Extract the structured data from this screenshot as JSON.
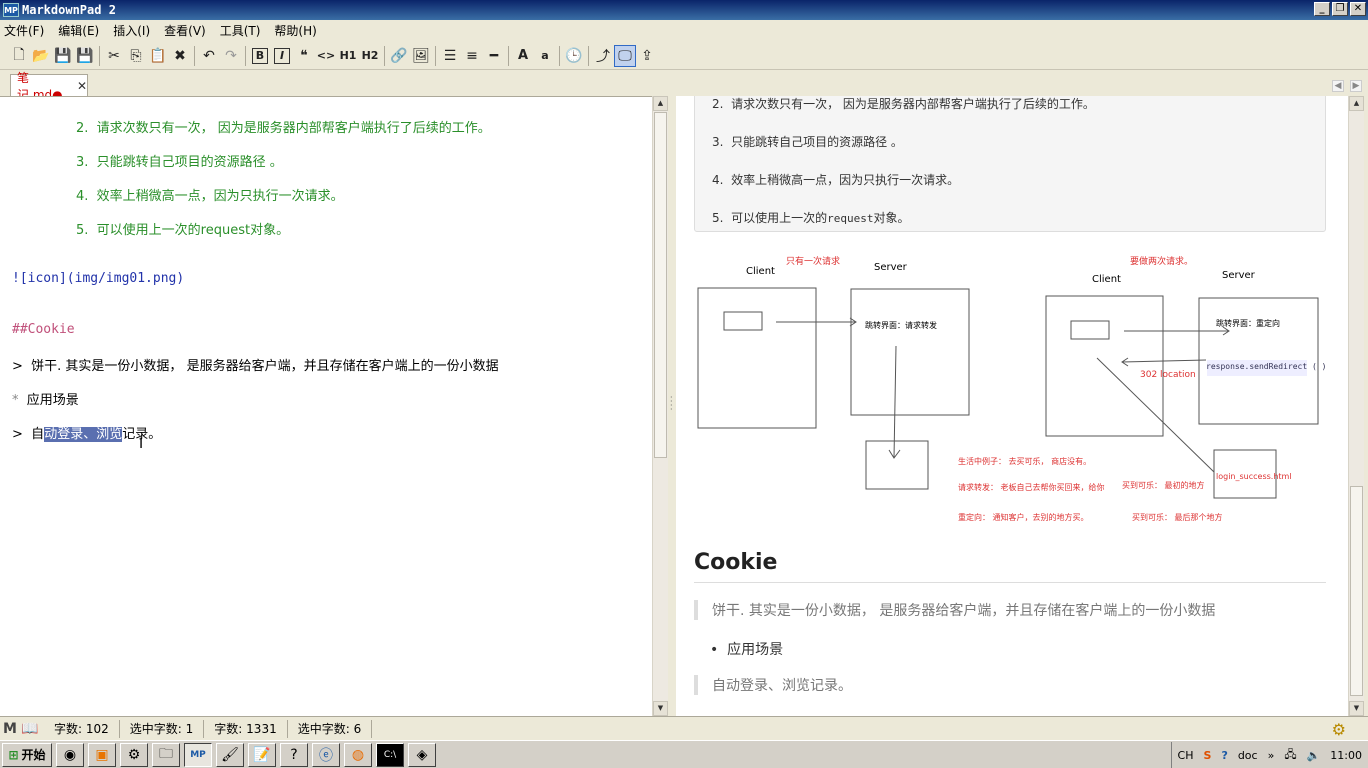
{
  "window": {
    "title": "MarkdownPad 2",
    "app_icon": "MP",
    "btn_minimize": "_",
    "btn_restore": "❐",
    "btn_close": "✕"
  },
  "menu": [
    "文件(F)",
    "编辑(E)",
    "插入(I)",
    "查看(V)",
    "工具(T)",
    "帮助(H)"
  ],
  "toolbar": {
    "h1": "H1",
    "h2": "H2",
    "bold": "B",
    "italic": "I",
    "font_big": "A",
    "font_small": "a",
    "quote": "❝",
    "code": "<>"
  },
  "tab": {
    "label": "笔记.md●",
    "close": "✕"
  },
  "editor": {
    "lines": [
      {
        "num": "2.",
        "text": "请求次数只有一次， 因为是服务器内部帮客户端执行了后续的工作。"
      },
      {
        "num": "3.",
        "text": "只能跳转自己项目的资源路径 。"
      },
      {
        "num": "4.",
        "text": "效率上稍微高一点，因为只执行一次请求。"
      },
      {
        "num": "5.",
        "text": "可以使用上一次的request对象。"
      }
    ],
    "image_md": "![icon](img/img01.png)",
    "heading_md": "##Cookie",
    "quote1_mark": ">",
    "quote1_text": "饼干. 其实是一份小数据， 是服务器给客户端，并且存储在客户端上的一份小数据",
    "list_mark": "*",
    "list_text": "应用场景",
    "quote2_mark": ">",
    "quote2_pre": "自",
    "quote2_sel": "动登录、浏览",
    "quote2_post": "记录。"
  },
  "preview": {
    "items": [
      {
        "num": "2.",
        "pre": "请求次数只有一次， 因为是服务器内部帮客户端执行了后续的工作。",
        "mono": "",
        "post": ""
      },
      {
        "num": "3.",
        "pre": "只能跳转自己项目的资源路径 。",
        "mono": "",
        "post": ""
      },
      {
        "num": "4.",
        "pre": "效率上稍微高一点，因为只执行一次请求。",
        "mono": "",
        "post": ""
      },
      {
        "num": "5.",
        "pre": "可以使用上一次的",
        "mono": "request",
        "post": "对象。"
      }
    ],
    "diagram": {
      "left_note": "只有一次请求",
      "left_client": "Client",
      "left_server": "Server",
      "left_server_text": "跳转界面：请求转发",
      "right_note": "要做两次请求。",
      "right_client": "Client",
      "right_server": "Server",
      "right_server_text": "跳转界面：重定向",
      "redirect_code": "response.sendRedirect ( )",
      "location": "302 location",
      "login_page": "login_success.html",
      "note1": "生活中例子：  去买可乐， 商店没有。",
      "note2": "请求转发： 老板自己去帮你买回来，给你",
      "note3": "买到可乐： 最初的地方",
      "note4": "重定向： 通知客户，去别的地方买。",
      "note5": "买到可乐： 最后那个地方"
    },
    "heading": "Cookie",
    "quote1": "饼干. 其实是一份小数据， 是服务器给客户端，并且存储在客户端上的一份小数据",
    "bullet": "应用场景",
    "quote2": "自动登录、浏览记录。"
  },
  "status": [
    {
      "label": "字数:",
      "value": "102"
    },
    {
      "label": "选中字数:",
      "value": "1"
    },
    {
      "label": "字数:",
      "value": "1331"
    },
    {
      "label": "选中字数:",
      "value": "6"
    }
  ],
  "taskbar": {
    "start": "开始",
    "ime": "CH",
    "doc": "doc",
    "time": "11:00"
  }
}
